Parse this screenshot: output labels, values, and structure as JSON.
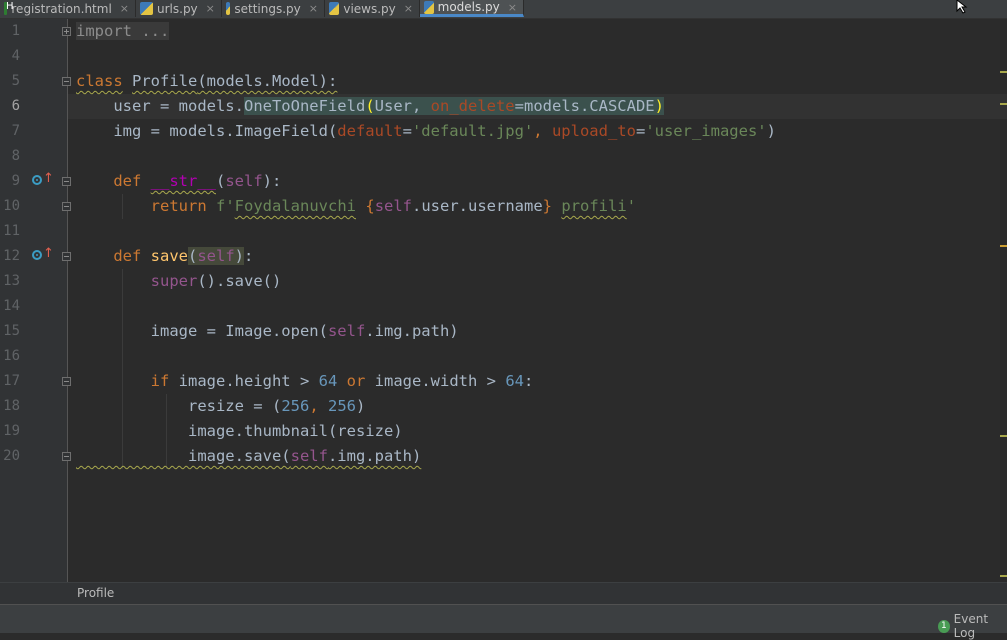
{
  "tabs": [
    {
      "label": "registration.html",
      "icon": "html-file-icon"
    },
    {
      "label": "urls.py",
      "icon": "python-file-icon"
    },
    {
      "label": "settings.py",
      "icon": "python-file-icon"
    },
    {
      "label": "views.py",
      "icon": "python-file-icon"
    },
    {
      "label": "models.py",
      "icon": "python-file-icon",
      "active": true
    }
  ],
  "close_glyph": "×",
  "line_numbers": [
    "1",
    "4",
    "5",
    "6",
    "7",
    "8",
    "9",
    "10",
    "11",
    "12",
    "13",
    "14",
    "15",
    "16",
    "17",
    "18",
    "19",
    "20"
  ],
  "code": {
    "l1_import": "import ...",
    "l5_class": "class",
    "l5_name": "Profile",
    "l5_rest": "(models.Model):",
    "l6_a": "    user = models.",
    "l6_b": "OneToOneField",
    "l6_paren_open": "(",
    "l6_c": "User, ",
    "l6_param": "on_delete",
    "l6_d": "=models.CASCADE",
    "l6_paren_close": ")",
    "l7_a": "    img = models.ImageField(",
    "l7_p1": "default",
    "l7_eq1": "=",
    "l7_s1": "'default.jpg'",
    "l7_comma": ", ",
    "l7_p2": "upload_to",
    "l7_eq2": "=",
    "l7_s2": "'user_images'",
    "l7_end": ")",
    "l9_indent": "    ",
    "l9_def": "def",
    "l9_sp": " ",
    "l9_name": "__str__",
    "l9_open": "(",
    "l9_self": "self",
    "l9_close": "):",
    "l10_indent": "        ",
    "l10_return": "return",
    "l10_sp": " ",
    "l10_str1": "f'",
    "l10_word1": "Foydalanuvchi",
    "l10_sp2": " ",
    "l10_brace1": "{",
    "l10_self": "self",
    "l10_expr": ".user.username",
    "l10_brace2": "}",
    "l10_sp3": " ",
    "l10_word2": "profili",
    "l10_q": "'",
    "l12_indent": "    ",
    "l12_def": "def",
    "l12_sp": " ",
    "l12_name": "save",
    "l12_open": "(",
    "l12_self": "self",
    "l12_close": ")",
    "l12_colon": ":",
    "l13_indent": "        ",
    "l13_super": "super",
    "l13_rest": "().save()",
    "l15_a": "        image = Image.open(",
    "l15_self": "self",
    "l15_b": ".img.path)",
    "l17_indent": "        ",
    "l17_if": "if",
    "l17_a": " image.height > ",
    "l17_n1": "64",
    "l17_sp": " ",
    "l17_or": "or",
    "l17_b": " image.width > ",
    "l17_n2": "64",
    "l17_c": ":",
    "l18_a": "            resize = (",
    "l18_n1": "256",
    "l18_comma": ", ",
    "l18_n2": "256",
    "l18_b": ")",
    "l19": "            image.thumbnail(resize)",
    "l20_a": "            image.save(",
    "l20_self": "self",
    "l20_b": ".img.path)"
  },
  "breadcrumb": "Profile",
  "status": {
    "event_count": "1",
    "event_log": "Event Log"
  },
  "colors": {
    "background": "#2b2b2b",
    "keyword": "#cc7832",
    "string": "#6a8759",
    "number": "#6897bb",
    "self": "#94558d",
    "param": "#aa4926",
    "dunder": "#b200b2",
    "accent": "#4a88c7"
  }
}
